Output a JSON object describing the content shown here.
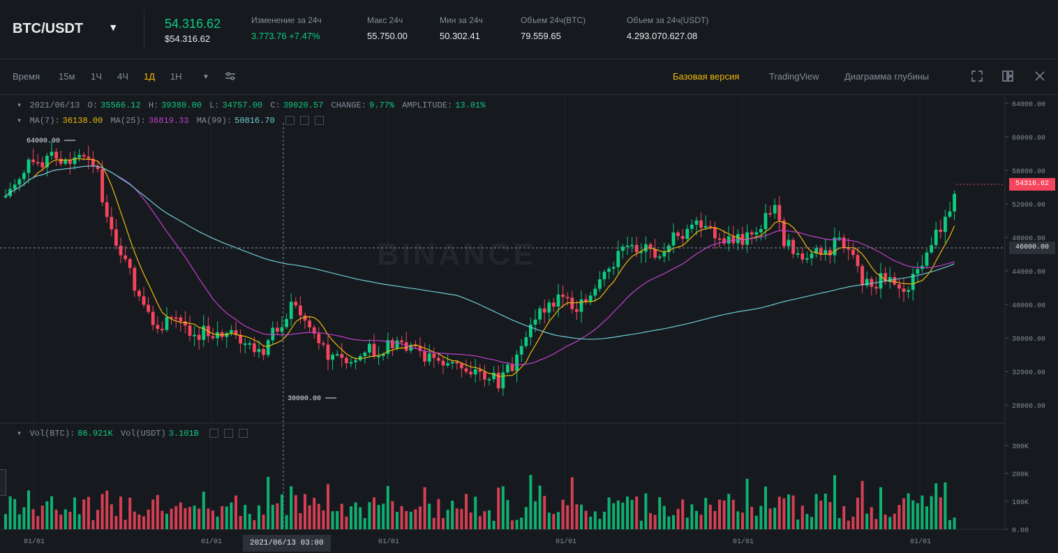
{
  "header": {
    "pair": "BTC/USDT",
    "last_price": "54.316.62",
    "last_price_usd": "$54.316.62",
    "stats": [
      {
        "label": "Изменение за 24ч",
        "value": "3.773.76 +7.47%",
        "color": "#0ecb81"
      },
      {
        "label": "Макс 24ч",
        "value": "55.750.00",
        "color": "#eaecef"
      },
      {
        "label": "Мин за 24ч",
        "value": "50.302.41",
        "color": "#eaecef"
      },
      {
        "label": "Объем 24ч(BTC)",
        "value": "79.559.65",
        "color": "#eaecef"
      },
      {
        "label": "Объем за 24ч(USDT)",
        "value": "4.293.070.627.08",
        "color": "#eaecef"
      }
    ]
  },
  "toolbar": {
    "time_label": "Время",
    "intervals": [
      "15м",
      "1Ч",
      "4Ч",
      "1Д",
      "1Н"
    ],
    "active_interval": "1Д",
    "views": [
      "Базовая версия",
      "TradingView",
      "Диаграмма глубины"
    ],
    "active_view": "Базовая версия"
  },
  "legend": {
    "ohlc_date": "2021/06/13",
    "o_label": "O:",
    "o": "35566.12",
    "h_label": "H:",
    "h": "39380.00",
    "l_label": "L:",
    "l": "34757.00",
    "c_label": "C:",
    "c": "39020.57",
    "change_label": "CHANGE:",
    "change": "9.77%",
    "amp_label": "AMPLITUDE:",
    "amp": "13.01%",
    "ma7_label": "MA(7):",
    "ma7": "36138.00",
    "ma25_label": "MA(25):",
    "ma25": "36819.33",
    "ma99_label": "MA(99):",
    "ma99": "50816.70",
    "vol_btc_label": "Vol(BTC):",
    "vol_btc": "86.921K",
    "vol_usdt_label": "Vol(USDT)",
    "vol_usdt": "3.101B"
  },
  "chart_annotations": {
    "high_marker": "64000.00",
    "low_marker": "30000.00",
    "current_price_tag": "54316.62",
    "crosshair_price_tag": "46000.00",
    "crosshair_time": "2021/06/13 03:00"
  },
  "axis": {
    "price_ticks": [
      "64000.00",
      "60000.00",
      "56000.00",
      "52000.00",
      "48000.00",
      "44000.00",
      "40000.00",
      "36000.00",
      "32000.00",
      "28000.00"
    ],
    "volume_ticks": [
      "300K",
      "200K",
      "100K",
      "0.00"
    ],
    "time_ticks": [
      "01/01",
      "01/01",
      "01/01",
      "01/01",
      "01/01",
      "01/01"
    ]
  },
  "colors": {
    "up": "#0ecb81",
    "down": "#f6465d",
    "ma7": "#f0b90b",
    "ma25": "#c33fd1",
    "ma99": "#6ecbd3",
    "accent": "#f0b90b",
    "background": "#161a1e"
  },
  "watermark": "BINANCE"
}
